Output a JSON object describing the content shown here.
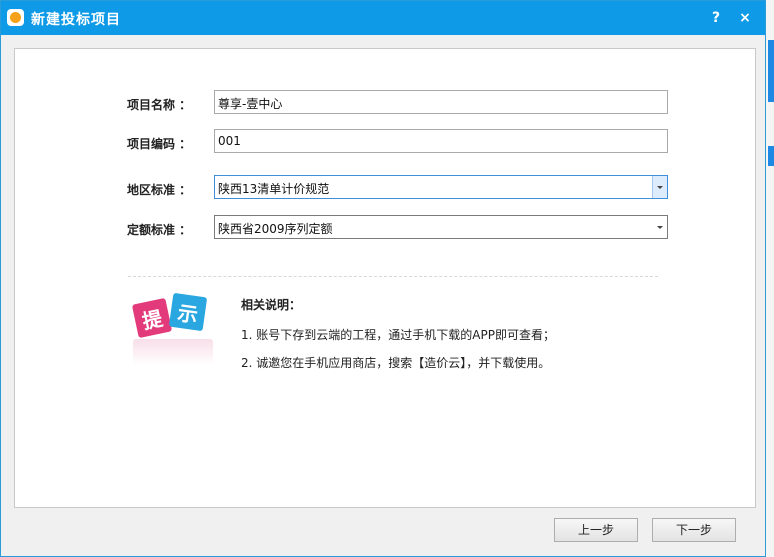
{
  "dialog": {
    "title": "新建投标项目",
    "help_label": "?",
    "close_label": "×"
  },
  "form": {
    "project_name": {
      "label": "项目名称 ：",
      "value": "尊享-壹中心"
    },
    "project_code": {
      "label": "项目编码 ：",
      "value": "001"
    },
    "region_standard": {
      "label": "地区标准 ：",
      "value": "陕西13清单计价规范"
    },
    "quota_standard": {
      "label": "定额标准 ：",
      "value": "陕西省2009序列定额"
    }
  },
  "hint": {
    "tile_1": "提",
    "tile_2": "示",
    "title": "相关说明：",
    "items": [
      "1. 账号下存到云端的工程，通过手机下载的APP即可查看；",
      "2. 诚邀您在手机应用商店，搜索【造价云】，并下载使用。"
    ]
  },
  "buttons": {
    "prev": "上一步",
    "next": "下一步"
  },
  "colors": {
    "titlebar": "#0f9ae7",
    "hint_pink": "#e23a7a",
    "hint_blue": "#2aa7e0"
  }
}
